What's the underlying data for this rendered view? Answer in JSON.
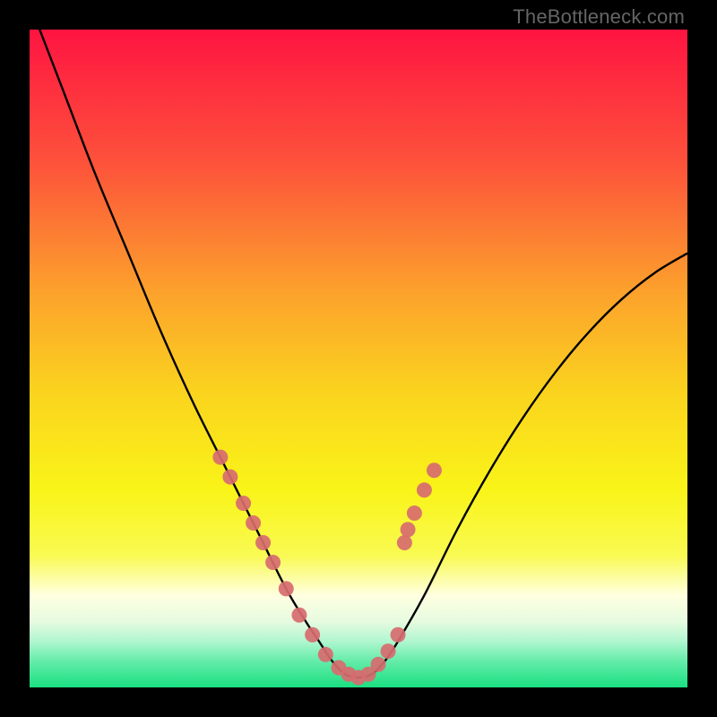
{
  "watermark": "TheBottleneck.com",
  "chart_data": {
    "type": "line",
    "title": "",
    "xlabel": "",
    "ylabel": "",
    "xlim": [
      0,
      100
    ],
    "ylim": [
      0,
      100
    ],
    "series": [
      {
        "name": "bottleneck-curve",
        "x": [
          0,
          5,
          10,
          15,
          20,
          25,
          30,
          35,
          39,
          42,
          44,
          46,
          48,
          50,
          52,
          54,
          56,
          60,
          65,
          70,
          75,
          80,
          85,
          90,
          95,
          100
        ],
        "y": [
          104,
          91,
          78,
          66,
          54,
          43,
          33,
          23,
          15,
          10,
          7,
          4,
          2,
          1.5,
          2,
          4,
          7,
          14,
          24,
          33,
          41,
          48,
          54,
          59,
          63,
          66
        ]
      }
    ],
    "markers": {
      "name": "highlight-points",
      "color": "#d76b6f",
      "x": [
        29,
        30.5,
        32.5,
        34,
        35.5,
        37,
        39,
        41,
        43,
        45,
        47,
        48.5,
        50,
        51.5,
        53,
        54.5,
        56,
        57,
        57.5,
        58.5,
        60,
        61.5
      ],
      "y": [
        35,
        32,
        28,
        25,
        22,
        19,
        15,
        11,
        8,
        5,
        3,
        2,
        1.5,
        2,
        3.5,
        5.5,
        8,
        22,
        24,
        26.5,
        30,
        33
      ]
    },
    "gradient_stops": [
      {
        "offset": 0.0,
        "color": "#fe1441"
      },
      {
        "offset": 0.2,
        "color": "#fd513b"
      },
      {
        "offset": 0.4,
        "color": "#fca22c"
      },
      {
        "offset": 0.55,
        "color": "#fad31e"
      },
      {
        "offset": 0.7,
        "color": "#f9f418"
      },
      {
        "offset": 0.8,
        "color": "#f9fa53"
      },
      {
        "offset": 0.86,
        "color": "#ffffe0"
      },
      {
        "offset": 0.9,
        "color": "#e6fbe0"
      },
      {
        "offset": 0.93,
        "color": "#b0f6cf"
      },
      {
        "offset": 0.96,
        "color": "#64eca9"
      },
      {
        "offset": 1.0,
        "color": "#1adf81"
      }
    ]
  }
}
